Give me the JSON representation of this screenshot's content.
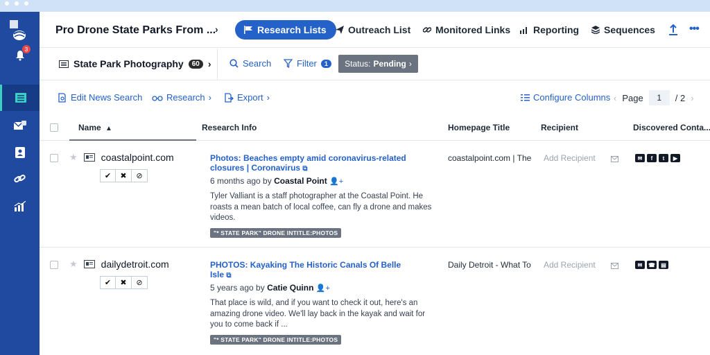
{
  "topbar": {
    "project_title": "Pro Drone State Parks From ...",
    "tabs": [
      {
        "label": "Research Lists",
        "active": true
      },
      {
        "label": "Outreach List"
      },
      {
        "label": "Monitored Links"
      },
      {
        "label": "Reporting"
      },
      {
        "label": "Sequences"
      }
    ]
  },
  "sidebar": {
    "notification_count": "3"
  },
  "subbar": {
    "list_name": "State Park Photography",
    "list_count": "60",
    "search_label": "Search",
    "filter_label": "Filter",
    "filter_count": "1",
    "status_prefix": "Status:",
    "status_value": "Pending"
  },
  "toolbar": {
    "edit_news_search": "Edit News Search",
    "research": "Research",
    "export": "Export",
    "configure_columns": "Configure Columns",
    "page_label": "Page",
    "page_current": "1",
    "page_total": "/ 2"
  },
  "table": {
    "headers": {
      "name": "Name",
      "research_info": "Research Info",
      "homepage_title": "Homepage Title",
      "recipient": "Recipient",
      "discovered_contacts": "Discovered Conta..."
    },
    "rows": [
      {
        "domain": "coastalpoint.com",
        "headline": "Photos: Beaches empty amid coronavirus-related closures | Coronavirus",
        "age": "6 months ago by",
        "author": "Coastal Point",
        "description": "Tyler Valliant is a staff photographer at the Coastal Point. He roasts a mean batch of local coffee, can fly a drone and makes videos.",
        "tag": "\"* STATE PARK\" DRONE INTITLE:PHOTOS",
        "homepage_title": "coastalpoint.com | The",
        "recipient": "Add Recipient"
      },
      {
        "domain": "dailydetroit.com",
        "headline": "PHOTOS: Kayaking The Historic Canals Of Belle Isle",
        "age": "5 years ago by",
        "author": "Catie Quinn",
        "description": "That place is wild, and if you want to check it out, here's an amazing drone video. We'll lay back in the kayak and wait for you to come back if ...",
        "tag": "\"* STATE PARK\" DRONE INTITLE:PHOTOS",
        "homepage_title": "Daily Detroit - What To",
        "recipient": "Add Recipient"
      }
    ]
  },
  "colors": {
    "brand_blue": "#2461c9",
    "sidebar": "#1f4aa0",
    "accent_teal": "#3ad1c4"
  }
}
